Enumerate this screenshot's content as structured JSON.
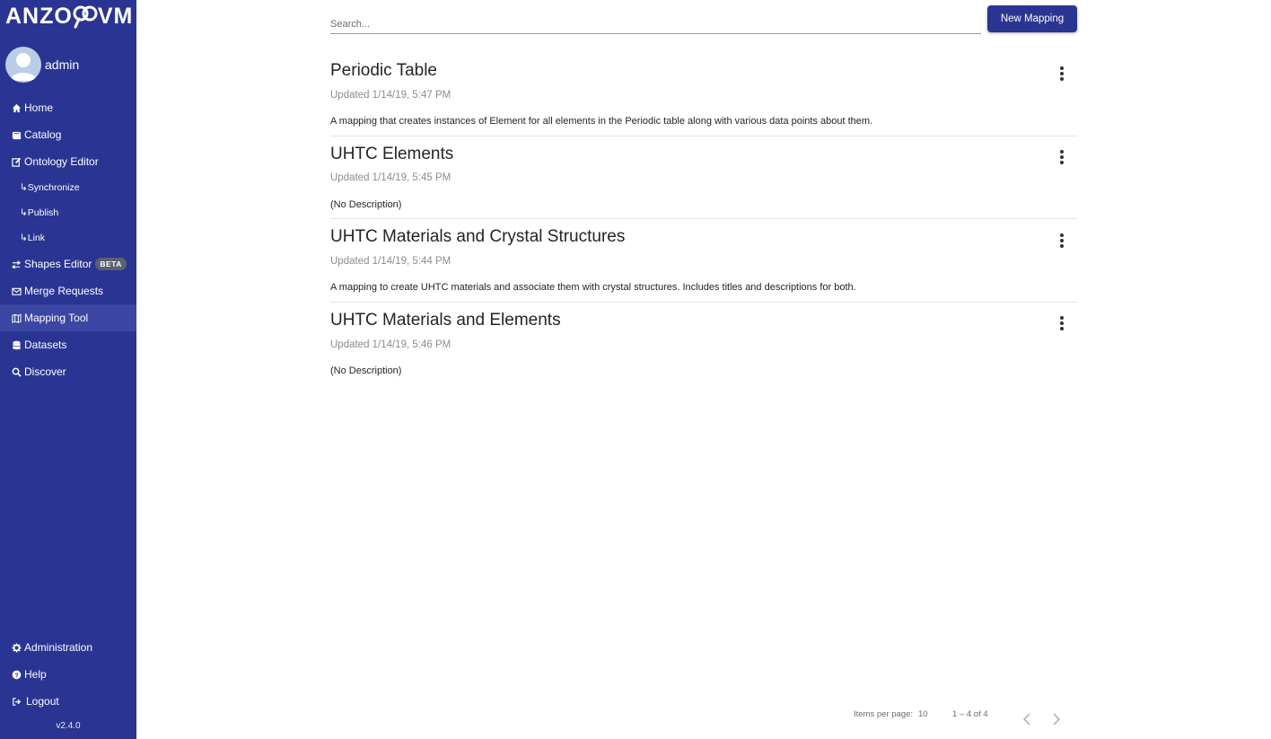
{
  "app": {
    "logo_text_left": "ANZO",
    "logo_text_right": "VM",
    "version": "v2.4.0"
  },
  "user": {
    "name": "admin"
  },
  "sidebar": {
    "items": [
      {
        "label": "Home",
        "icon": "home-icon"
      },
      {
        "label": "Catalog",
        "icon": "book-icon"
      },
      {
        "label": "Ontology Editor",
        "icon": "edit-icon"
      },
      {
        "label": "↳Synchronize",
        "icon": ""
      },
      {
        "label": "↳Publish",
        "icon": ""
      },
      {
        "label": "↳Link",
        "icon": ""
      },
      {
        "label": "Shapes Editor",
        "icon": "shapes-icon",
        "badge": "BETA"
      },
      {
        "label": "Merge Requests",
        "icon": "envelope-icon"
      },
      {
        "label": "Mapping Tool",
        "icon": "map-icon",
        "active": true
      },
      {
        "label": "Datasets",
        "icon": "database-icon"
      },
      {
        "label": "Discover",
        "icon": "search-icon"
      }
    ],
    "bottom_items": [
      {
        "label": "Administration",
        "icon": "gear-icon"
      },
      {
        "label": "Help",
        "icon": "question-icon"
      },
      {
        "label": "Logout",
        "icon": "logout-icon"
      }
    ]
  },
  "search": {
    "placeholder": "Search..."
  },
  "toolbar": {
    "new_mapping_label": "New Mapping"
  },
  "mappings": [
    {
      "title": "Periodic Table",
      "updated": "Updated 1/14/19, 5:47 PM",
      "description": "A mapping that creates instances of Element for all elements in the Periodic table along with various data points about them."
    },
    {
      "title": "UHTC Elements",
      "updated": "Updated 1/14/19, 5:45 PM",
      "description": "(No Description)"
    },
    {
      "title": "UHTC Materials and Crystal Structures",
      "updated": "Updated 1/14/19, 5:44 PM",
      "description": "A mapping to create UHTC materials and associate them with crystal structures. Includes titles and descriptions for both."
    },
    {
      "title": "UHTC Materials and Elements",
      "updated": "Updated 1/14/19, 5:46 PM",
      "description": "(No Description)"
    }
  ],
  "paginator": {
    "items_per_page_label": "Items per page:",
    "items_per_page": "10",
    "range": "1 – 4 of 4"
  },
  "colors": {
    "sidebar_bg": "#2a3593",
    "active_item_bg": "#3c46a3",
    "accent": "#2a3593"
  }
}
